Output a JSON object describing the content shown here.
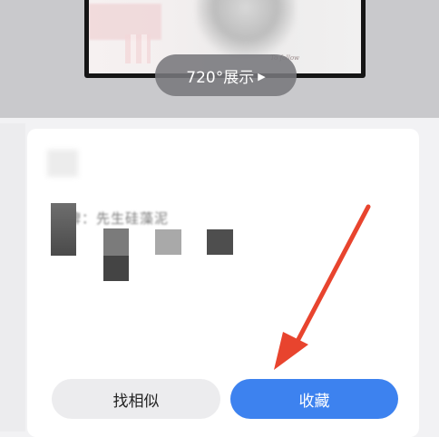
{
  "preview": {
    "badge_label": "720°展示",
    "caption": "To follow"
  },
  "product": {
    "brand_line": "品牌：先生硅藻泥"
  },
  "actions": {
    "similar_label": "找相似",
    "favorite_label": "收藏"
  },
  "colors": {
    "favorite_button": "#3d82ef",
    "similar_button": "#ececee",
    "annotation_arrow": "#e8442e"
  }
}
